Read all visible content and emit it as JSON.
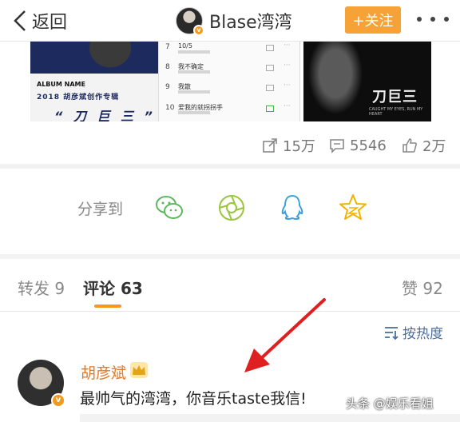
{
  "header": {
    "back_label": "返回",
    "account_name": "Blase湾湾",
    "follow_label": "+关注"
  },
  "album": {
    "left_album_name": "ALBUM NAME",
    "left_subtitle": "2018 胡彦斌创作专辑",
    "left_big_title": "“ 刀 巨 三 ”",
    "tracks": [
      {
        "no": "7",
        "title": "10/5"
      },
      {
        "no": "8",
        "title": "我不确定"
      },
      {
        "no": "9",
        "title": "我散"
      },
      {
        "no": "10",
        "title": "爱我的就拐拐手"
      }
    ],
    "right_logo": "刀巨三",
    "right_tagline": "CAUGHT MY EYES, RUN MY HEART"
  },
  "stats": {
    "shares": "15万",
    "comments": "5546",
    "likes": "2万"
  },
  "share": {
    "label": "分享到",
    "targets": [
      "wechat",
      "moments",
      "qq",
      "qzone"
    ]
  },
  "tabs": [
    {
      "label": "转发 9",
      "active": false
    },
    {
      "label": "评论 63",
      "active": true
    },
    {
      "label": "赞 92",
      "active": false
    }
  ],
  "sort_label": "按热度",
  "comment": {
    "author": "胡彦斌",
    "text": "最帅气的湾湾，你音乐taste我信!"
  },
  "watermark": "头条 @娱乐看姐",
  "colors": {
    "accent": "#f39a1e",
    "follow_button": "#f6a237",
    "author_name": "#e27a2a",
    "link_blue": "#4a6f9c",
    "arrow_red": "#e02020"
  }
}
